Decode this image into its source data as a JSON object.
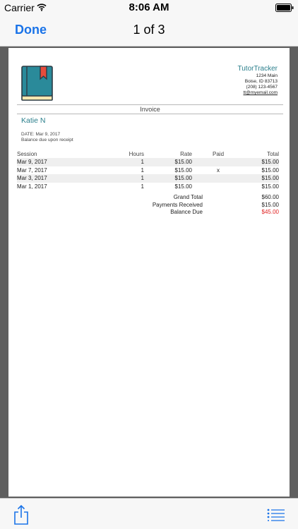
{
  "status_bar": {
    "carrier": "Carrier",
    "time": "8:06 AM",
    "icons": [
      "wifi-icon",
      "battery-icon"
    ]
  },
  "nav": {
    "done_label": "Done",
    "page_indicator": "1 of 3"
  },
  "colors": {
    "accent": "#1a73e8",
    "brand_teal": "#2b7f8c",
    "balance_due": "#e02020",
    "book_cover": "#2a8a9a",
    "bookmark": "#e74c3c"
  },
  "invoice": {
    "logo_icon": "book-icon",
    "company": {
      "name": "TutorTracker",
      "address1": "1234 Main",
      "address2": "Boise, ID 83713",
      "phone": "(208) 123-4567",
      "email": "tt@myemail.com"
    },
    "heading": "Invoice",
    "client": "Katie N",
    "date_line": "DATE:  Mar 9, 2017",
    "terms": "Balance due upon receipt",
    "columns": {
      "session": "Session",
      "hours": "Hours",
      "rate": "Rate",
      "paid": "Paid",
      "total": "Total"
    },
    "rows": [
      {
        "session": "Mar 9, 2017",
        "hours": "1",
        "rate": "$15.00",
        "paid": "",
        "total": "$15.00"
      },
      {
        "session": "Mar 7, 2017",
        "hours": "1",
        "rate": "$15.00",
        "paid": "x",
        "total": "$15.00"
      },
      {
        "session": "Mar 3, 2017",
        "hours": "1",
        "rate": "$15.00",
        "paid": "",
        "total": "$15.00"
      },
      {
        "session": "Mar 1, 2017",
        "hours": "1",
        "rate": "$15.00",
        "paid": "",
        "total": "$15.00"
      }
    ],
    "totals": {
      "grand_total_label": "Grand Total",
      "grand_total": "$60.00",
      "payments_label": "Payments Received",
      "payments": "$15.00",
      "balance_label": "Balance Due",
      "balance": "$45.00"
    }
  },
  "toolbar": {
    "share_icon": "share-icon",
    "list_icon": "list-icon"
  }
}
